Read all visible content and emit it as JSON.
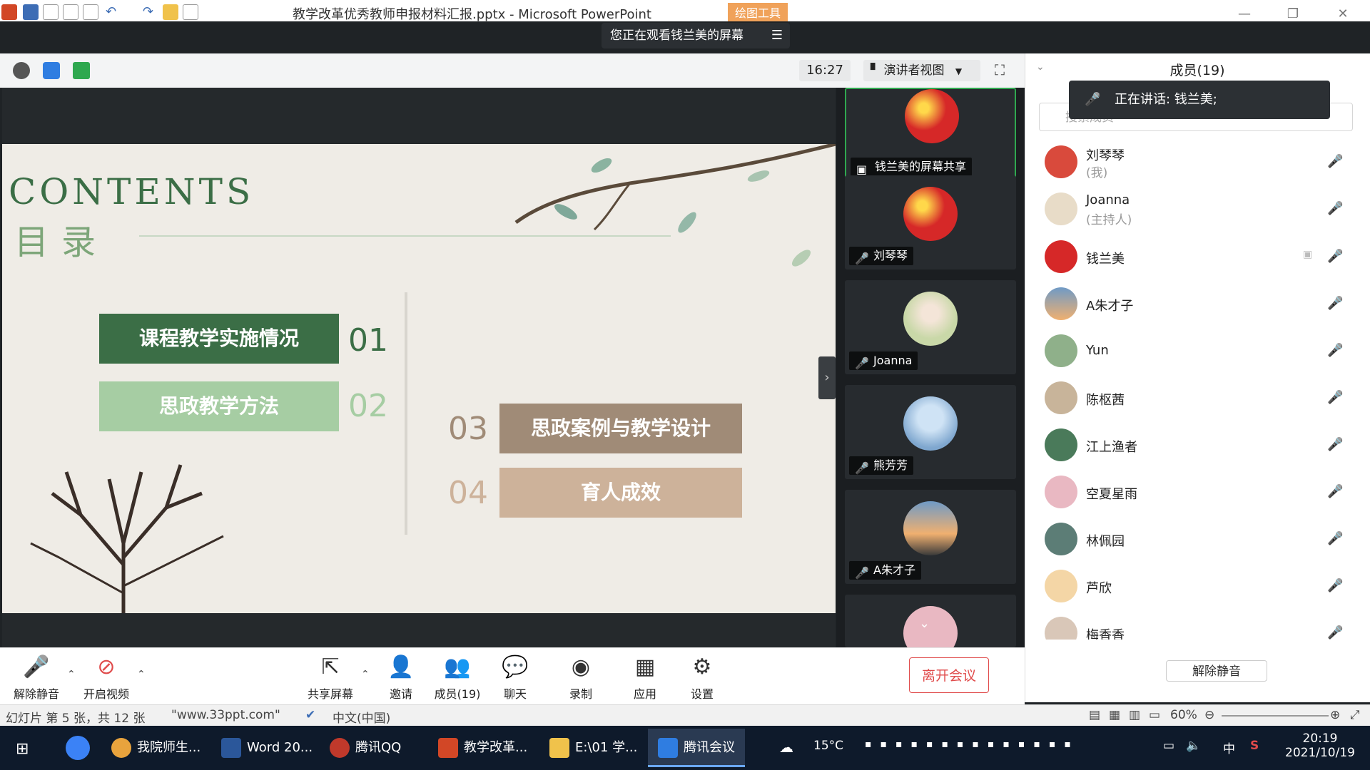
{
  "ppt": {
    "title": "教学改革优秀教师申报材料汇报.pptx - Microsoft PowerPoint",
    "context_tab": "绘图工具"
  },
  "meeting": {
    "share_notice": "您正在观看钱兰美的屏幕",
    "menu_icon": "☰",
    "time": "16:27",
    "view_mode": "演讲者视图",
    "toolbar": {
      "unmute": "解除静音",
      "video": "开启视频",
      "share": "共享屏幕",
      "invite": "邀请",
      "members": "成员(19)",
      "chat": "聊天",
      "record": "录制",
      "apps": "应用",
      "settings": "设置",
      "leave": "离开会议"
    }
  },
  "slide": {
    "heading_en": "CONTENTS",
    "heading_cn": "目录",
    "items": [
      {
        "num": "01",
        "label": "课程教学实施情况"
      },
      {
        "num": "02",
        "label": "思政教学方法"
      },
      {
        "num": "03",
        "label": "思政案例与教学设计"
      },
      {
        "num": "04",
        "label": "育人成效"
      }
    ]
  },
  "video_tiles": [
    {
      "label": "钱兰美的屏幕共享"
    },
    {
      "label": "刘琴琴"
    },
    {
      "label": "Joanna"
    },
    {
      "label": "熊芳芳"
    },
    {
      "label": "A朱才子"
    }
  ],
  "panel": {
    "title": "成员(19)",
    "speaking": "正在讲话: 钱兰美;",
    "search_placeholder": "搜索成员",
    "unmute_all": "解除静音",
    "members": [
      {
        "name": "刘琴琴",
        "role": "(我)"
      },
      {
        "name": "Joanna",
        "role": "(主持人)"
      },
      {
        "name": "钱兰美",
        "role": ""
      },
      {
        "name": "A朱才子",
        "role": ""
      },
      {
        "name": "Yun",
        "role": ""
      },
      {
        "name": "陈枢茜",
        "role": ""
      },
      {
        "name": "江上渔者",
        "role": ""
      },
      {
        "name": "空夏星雨",
        "role": ""
      },
      {
        "name": "林佩园",
        "role": ""
      },
      {
        "name": "芦欣",
        "role": ""
      },
      {
        "name": "梅香香",
        "role": ""
      }
    ]
  },
  "status": {
    "slide_info": "幻灯片 第 5 张，共 12 张",
    "theme": "\"www.33ppt.com\"",
    "language": "中文(中国)",
    "zoom": "60%"
  },
  "taskbar": {
    "apps": [
      "我院师生...",
      "Word 20...",
      "腾讯QQ",
      "教学改革...",
      "E:\\01 学...",
      "腾讯会议"
    ],
    "weather": "15°C",
    "ime": "中",
    "time": "20:19",
    "date": "2021/10/19"
  },
  "colors": {
    "slide_green_dark": "#3b6e46",
    "slide_green_light": "#a6cda3",
    "slide_brown_dark": "#a08b77",
    "slide_brown_light": "#cdb29a",
    "leave_red": "#e04b4b"
  }
}
